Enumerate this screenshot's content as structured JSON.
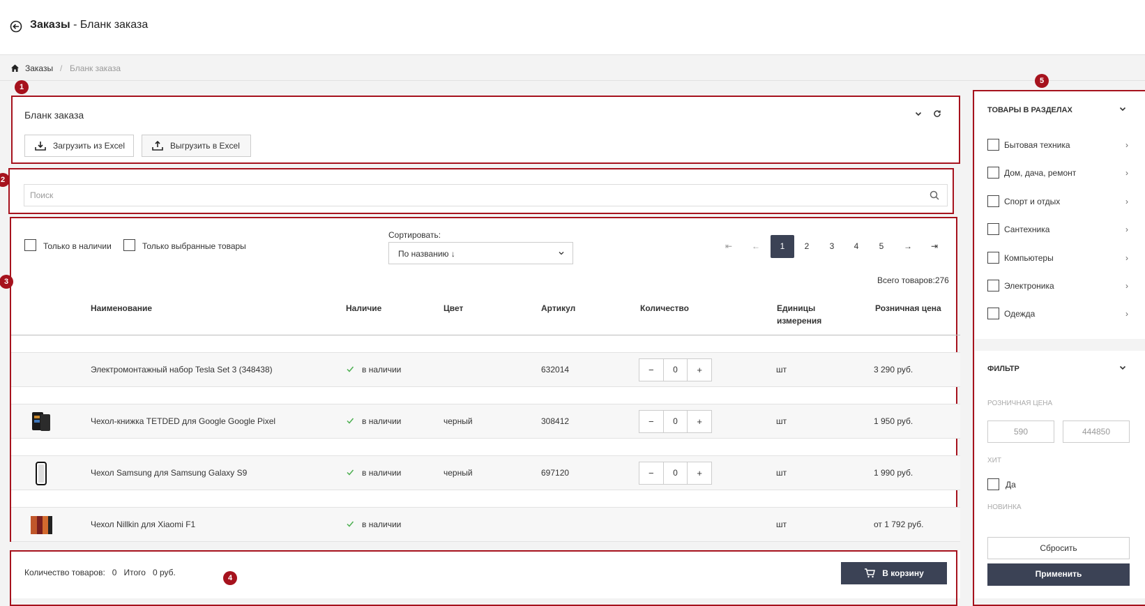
{
  "header": {
    "title_bold": "Заказы",
    "title_rest": " - Бланк заказа"
  },
  "breadcrumb": {
    "home": "Заказы",
    "separator": "/",
    "current": "Бланк заказа"
  },
  "markers": [
    "1",
    "2",
    "3",
    "4",
    "5"
  ],
  "order_form": {
    "title": "Бланк заказа",
    "upload_label": "Загрузить из Excel",
    "download_label": "Выгрузить в Excel"
  },
  "search": {
    "placeholder": "Поиск"
  },
  "filters_bar": {
    "in_stock_label": "Только в наличии",
    "selected_label": "Только выбранные товары",
    "sort_label": "Сортировать:",
    "sort_value": "По названию ↓",
    "pagination": [
      "⇤",
      "←",
      "1",
      "2",
      "3",
      "4",
      "5",
      "→",
      "⇥"
    ],
    "active_page": "1",
    "total_label": "Всего товаров:",
    "total_value": "276"
  },
  "table": {
    "columns": [
      "Наименование",
      "Наличие",
      "Цвет",
      "Артикул",
      "Количество",
      "Единицы измерения",
      "Розничная цена"
    ],
    "rows": [
      {
        "name": "Электромонтажный набор Tesla Set 3 (348438)",
        "stock": "в наличии",
        "color": "",
        "sku": "632014",
        "qty": "0",
        "unit": "шт",
        "price": "3 290 руб.",
        "thumb": ""
      },
      {
        "name": "Чехол-книжка TETDED для Google Google Pixel",
        "stock": "в наличии",
        "color": "черный",
        "sku": "308412",
        "qty": "0",
        "unit": "шт",
        "price": "1 950 руб.",
        "thumb": "wallet-case"
      },
      {
        "name": "Чехол Samsung для Samsung Galaxy S9",
        "stock": "в наличии",
        "color": "черный",
        "sku": "697120",
        "qty": "0",
        "unit": "шт",
        "price": "1 990 руб.",
        "thumb": "phone-case"
      },
      {
        "name": "Чехол Nillkin для Xiaomi F1",
        "stock": "в наличии",
        "color": "",
        "sku": "",
        "qty": "",
        "unit": "шт",
        "price": "от 1 792 руб.",
        "thumb": "colored-cases"
      }
    ],
    "stepper_minus": "−",
    "stepper_plus": "+"
  },
  "footer": {
    "qty_label": "Количество товаров:",
    "qty_value": "0",
    "total_label": "Итого",
    "total_value": "0 руб.",
    "cart_label": "В корзину"
  },
  "sidebar": {
    "sections_title": "ТОВАРЫ В РАЗДЕЛАХ",
    "categories": [
      "Бытовая техника",
      "Дом, дача, ремонт",
      "Спорт и отдых",
      "Сантехника",
      "Компьютеры",
      "Электроника",
      "Одежда"
    ],
    "filter_title": "ФИЛЬТР",
    "price_label": "РОЗНИЧНАЯ ЦЕНА",
    "price_min": "590",
    "price_max": "444850",
    "hit_label": "ХИТ",
    "hit_option": "Да",
    "new_label": "НОВИНКА",
    "reset_label": "Сбросить",
    "apply_label": "Применить"
  },
  "colors": {
    "accent": "#a6121d",
    "dark_button": "#3b4255",
    "check": "#4caf50"
  }
}
